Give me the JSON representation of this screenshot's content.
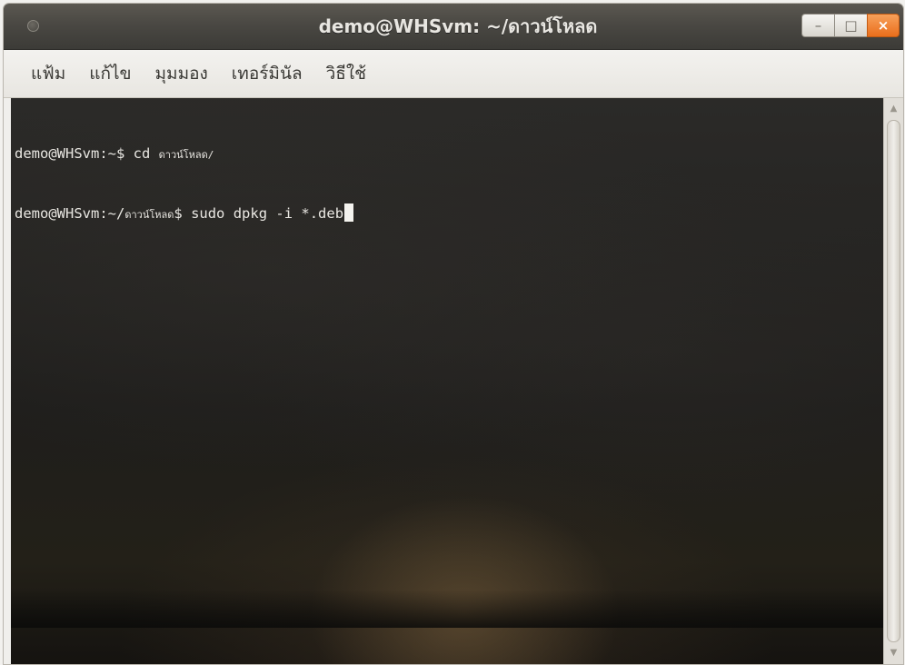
{
  "window": {
    "title": "demo@WHSvm: ~/ดาวน์โหลด",
    "buttons": {
      "minimize_glyph": "–",
      "maximize_glyph": "□",
      "close_glyph": "×"
    }
  },
  "menubar": {
    "items": [
      {
        "label": "แฟ้ม"
      },
      {
        "label": "แก้ไข"
      },
      {
        "label": "มุมมอง"
      },
      {
        "label": "เทอร์มินัล"
      },
      {
        "label": "วิธีใช้"
      }
    ]
  },
  "terminal": {
    "lines": [
      {
        "prompt": "demo@WHSvm:~$",
        "command_prefix": " cd ",
        "command_arg": "ดาวน์โหลด/"
      },
      {
        "prompt_user": "demo@WHSvm:~/",
        "prompt_path": "ดาวน์โหลด",
        "prompt_end": "$",
        "command": " sudo dpkg -i *.deb"
      }
    ]
  },
  "scrollbar": {
    "up_glyph": "▲",
    "down_glyph": "▼"
  }
}
